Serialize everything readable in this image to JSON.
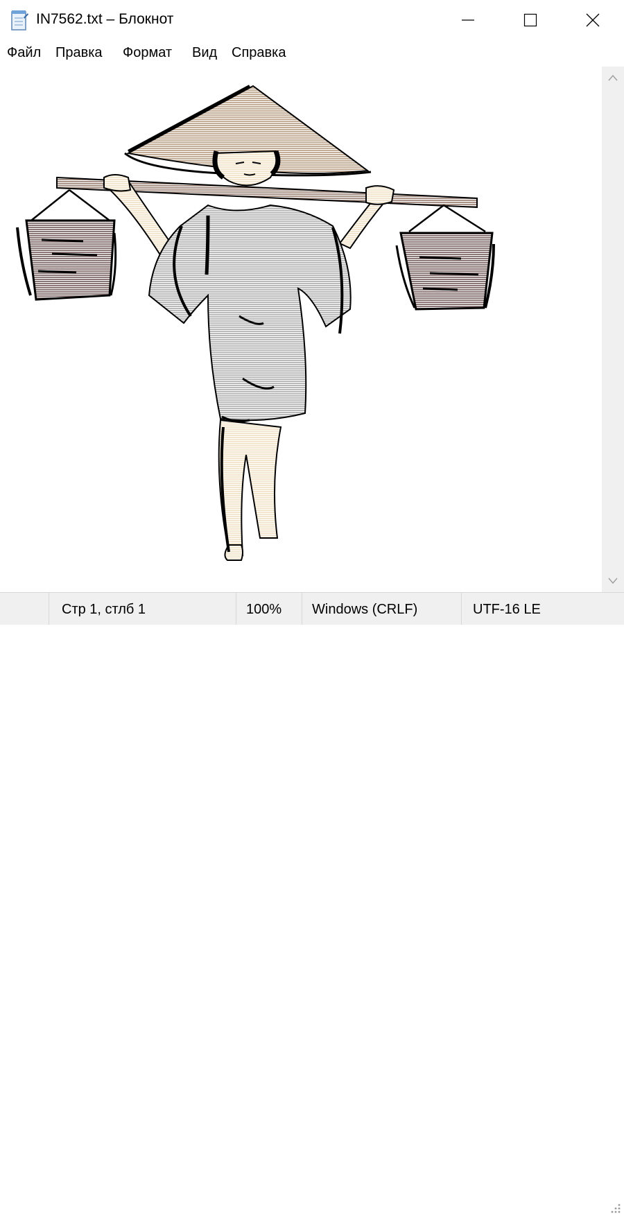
{
  "window": {
    "title": "IN7562.txt – Блокнот",
    "icon": "notepad-icon",
    "controls": [
      "minimize-icon",
      "maximize-icon",
      "close-icon"
    ]
  },
  "menu": {
    "items": [
      "Файл",
      "Правка",
      "Формат",
      "Вид",
      "Справка"
    ]
  },
  "editor": {
    "content_description_icon": "ascii-art-water-carrier"
  },
  "status": {
    "position": "Стр 1, стлб 1",
    "zoom": "100%",
    "line_endings": "Windows (CRLF)",
    "encoding": "UTF-16 LE"
  },
  "colors": {
    "hat": "#c4ad97",
    "skin": "#f3e6cf",
    "robe": "#b9b9b9",
    "bucket": "#8a7675",
    "pole": "#a89288",
    "outline": "#000000"
  }
}
